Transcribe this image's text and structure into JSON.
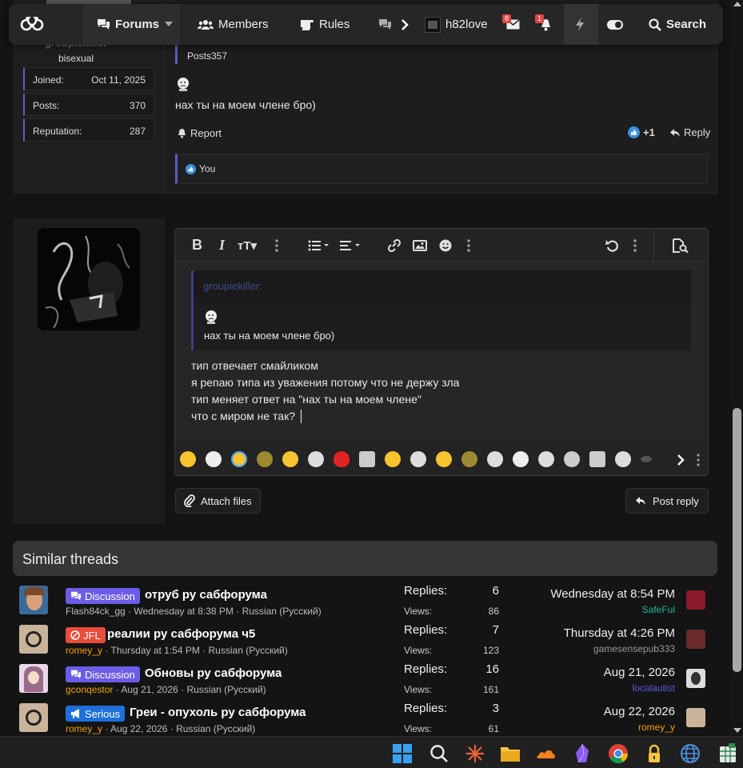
{
  "nav": {
    "forums": "Forums",
    "members": "Members",
    "rules": "Rules",
    "username": "h82love",
    "inbox_badge": "8",
    "alerts_badge": "1",
    "search": "Search"
  },
  "post": {
    "author_name": "groupiekiller",
    "author_role": "bisexual",
    "stats": [
      {
        "key": "Joined:",
        "value": "Oct 11, 2025"
      },
      {
        "key": "Posts:",
        "value": "370"
      },
      {
        "key": "Reputation:",
        "value": "287"
      }
    ],
    "quote_posts": "Posts357",
    "message": "нах ты на моем члене бро)",
    "report": "Report",
    "reaction_count": "+1",
    "reply": "Reply",
    "liked_by": "You"
  },
  "editor": {
    "quote_author": "groupiekiller:",
    "quote_text": "нах ты на моем члене бро)",
    "lines": [
      "тип отвечает смайликом",
      "я репаю типа из уважения потому что не держу зла",
      "тип меняет ответ на \"нах ты на моем члене\"",
      "что с миром не так?"
    ],
    "attach": "Attach files",
    "post_reply": "Post reply"
  },
  "similar": {
    "heading": "Similar threads",
    "replies_label": "Replies:",
    "views_label": "Views:",
    "threads": [
      {
        "tag": "Discussion",
        "tag_color": "#6c5ce7",
        "title": "отруб ру сабфорума",
        "author": "Flash84ck_gg",
        "author_color": "#bbbbbb",
        "meta": "Wednesday at 8:38 PM · Russian (Русский)",
        "replies": "6",
        "views": "86",
        "last_date": "Wednesday at 8:54 PM",
        "last_user": "SafeFul",
        "last_user_color": "#1abc9c"
      },
      {
        "tag": "JFL",
        "tag_color": "#e74c3c",
        "title": "реалии ру сабфорума ч5",
        "author": "romey_y",
        "author_color": "#f2a000",
        "meta": "Thursday at 1:54 PM · Russian (Русский)",
        "replies": "7",
        "views": "123",
        "last_date": "Thursday at 4:26 PM",
        "last_user": "gamesensepub333",
        "last_user_color": "#999999"
      },
      {
        "tag": "Discussion",
        "tag_color": "#6c5ce7",
        "title": "Обновы ру сабфорума",
        "author": "gconqestor",
        "author_color": "#f2a000",
        "meta": "Aug 21, 2026 · Russian (Русский)",
        "replies": "16",
        "views": "161",
        "last_date": "Aug 21, 2026",
        "last_user": "localautist",
        "last_user_color": "#5b5bdf"
      },
      {
        "tag": "Serious",
        "tag_color": "#1e6fd9",
        "title": "Греи - опухоль ру сабфорума",
        "author": "romey_y",
        "author_color": "#f2a000",
        "meta": "Aug 22, 2026 · Russian (Русский)",
        "replies": "3",
        "views": "61",
        "last_date": "Aug 22, 2026",
        "last_user": "romey_y",
        "last_user_color": "#f2a000"
      }
    ]
  },
  "colors": {
    "accent": "#5b5bbf",
    "background": "#141414",
    "panel": "#1d1d1d"
  }
}
